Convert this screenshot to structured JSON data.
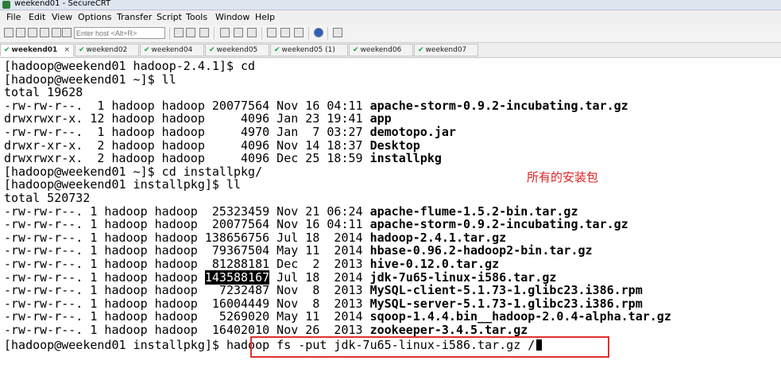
{
  "window": {
    "title": "weekend01 - SecureCRT"
  },
  "menu": [
    "File",
    "Edit",
    "View",
    "Options",
    "Transfer",
    "Script",
    "Tools",
    "Window",
    "Help"
  ],
  "toolbar": {
    "host_placeholder": "Enter host <Alt+R>"
  },
  "tabs": [
    {
      "label": "weekend01",
      "active": true,
      "close": "×"
    },
    {
      "label": "weekend02"
    },
    {
      "label": "weekend04"
    },
    {
      "label": "weekend05"
    },
    {
      "label": "weekend05 (1)"
    },
    {
      "label": "weekend06"
    },
    {
      "label": "weekend07"
    }
  ],
  "terminal": {
    "lines": [
      {
        "text": "[hadoop@weekend01 hadoop-2.4.1]$ cd"
      },
      {
        "text": "[hadoop@weekend01 ~]$ ll"
      },
      {
        "text": "total 19628"
      },
      {
        "text": "-rw-rw-r--.  1 hadoop hadoop 20077564 Nov 16 04:11 ",
        "file": "apache-storm-0.9.2-incubating.tar.gz"
      },
      {
        "text": "drwxrwxr-x. 12 hadoop hadoop     4096 Jan 23 19:41 ",
        "file": "app"
      },
      {
        "text": "-rw-rw-r--.  1 hadoop hadoop     4970 Jan  7 03:27 ",
        "file": "demotopo.jar"
      },
      {
        "text": "drwxr-xr-x.  2 hadoop hadoop     4096 Nov 14 18:37 ",
        "file": "Desktop"
      },
      {
        "text": "drwxrwxr-x.  2 hadoop hadoop     4096 Dec 25 18:59 ",
        "file": "installpkg"
      },
      {
        "text": "[hadoop@weekend01 ~]$ cd installpkg/"
      },
      {
        "text": "[hadoop@weekend01 installpkg]$ ll"
      },
      {
        "text": "total 520732"
      },
      {
        "text": "-rw-rw-r--. 1 hadoop hadoop  25323459 Nov 21 06:24 ",
        "file": "apache-flume-1.5.2-bin.tar.gz"
      },
      {
        "text": "-rw-rw-r--. 1 hadoop hadoop  20077564 Nov 16 04:11 ",
        "file": "apache-storm-0.9.2-incubating.tar.gz"
      },
      {
        "text": "-rw-rw-r--. 1 hadoop hadoop 138656756 Jul 18  2014 ",
        "file": "hadoop-2.4.1.tar.gz"
      },
      {
        "text": "-rw-rw-r--. 1 hadoop hadoop  79367504 May 11  2014 ",
        "file": "hbase-0.96.2-hadoop2-bin.tar.gz"
      },
      {
        "text": "-rw-rw-r--. 1 hadoop hadoop  81288181 Dec  2  2013 ",
        "file": "hive-0.12.0.tar.gz"
      },
      {
        "pre": "-rw-rw-r--. 1 hadoop hadoop ",
        "highlight": "143588167",
        "text": " Jul 18  2014 ",
        "file": "jdk-7u65-linux-i586.tar.gz"
      },
      {
        "text": "-rw-rw-r--. 1 hadoop hadoop   7232487 Nov  8  2013 ",
        "file": "MySQL-client-5.1.73-1.glibc23.i386.rpm"
      },
      {
        "text": "-rw-rw-r--. 1 hadoop hadoop  16004449 Nov  8  2013 ",
        "file": "MySQL-server-5.1.73-1.glibc23.i386.rpm"
      },
      {
        "text": "-rw-rw-r--. 1 hadoop hadoop   5269020 May 11  2014 ",
        "file": "sqoop-1.4.4.bin__hadoop-2.0.4-alpha.tar.gz"
      },
      {
        "text": "-rw-rw-r--. 1 hadoop hadoop  16402010 Nov 26  2013 ",
        "file": "zookeeper-3.4.5.tar.gz"
      }
    ],
    "prompt": "[hadoop@weekend01 installpkg]$ ",
    "command": "hadoop fs -put jdk-7u65-linux-i586.tar.gz /"
  },
  "annotation": {
    "text": "所有的安装包",
    "color": "#e02020"
  },
  "colors": {
    "highlight_box": "#e03030",
    "check": "#16a34a"
  }
}
